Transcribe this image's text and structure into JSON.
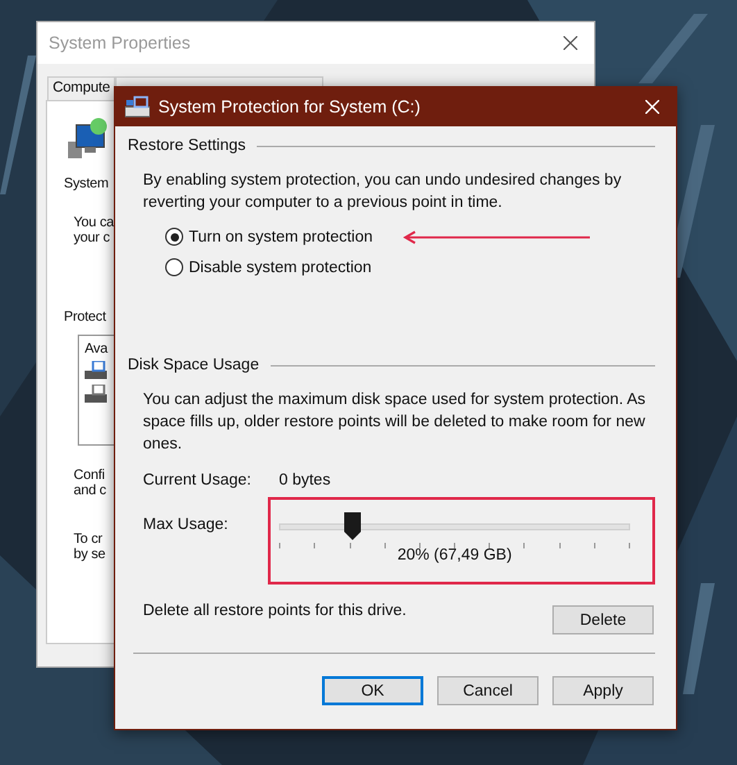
{
  "background_window": {
    "title": "System Properties",
    "tabs": [
      {
        "label": "Compute",
        "selected": false
      }
    ],
    "section_label": "System",
    "description_lines": [
      "You ca",
      "your c"
    ],
    "protection_label": "Protect",
    "drives_header": "Ava",
    "configure_lines": [
      "Confi",
      "and c"
    ],
    "create_lines": [
      "To cr",
      "by se"
    ]
  },
  "dialog": {
    "title": "System Protection for System (C:)",
    "restore_settings": {
      "heading": "Restore Settings",
      "description": "By enabling system protection, you can undo undesired changes by reverting your computer to a previous point in time.",
      "options": [
        {
          "label": "Turn on system protection",
          "selected": true
        },
        {
          "label": "Disable system protection",
          "selected": false
        }
      ]
    },
    "disk_space": {
      "heading": "Disk Space Usage",
      "description": "You can adjust the maximum disk space used for system protection. As space fills up, older restore points will be deleted to make room for new ones.",
      "current_usage_label": "Current Usage:",
      "current_usage_value": "0 bytes",
      "max_usage_label": "Max Usage:",
      "slider": {
        "level": 0.21,
        "reading": "20% (67,49 GB)"
      },
      "delete_text": "Delete all restore points for this drive.",
      "delete_button": "Delete"
    },
    "buttons": [
      {
        "label": "OK",
        "default": true
      },
      {
        "label": "Cancel",
        "default": false
      },
      {
        "label": "Apply",
        "default": false
      }
    ]
  }
}
